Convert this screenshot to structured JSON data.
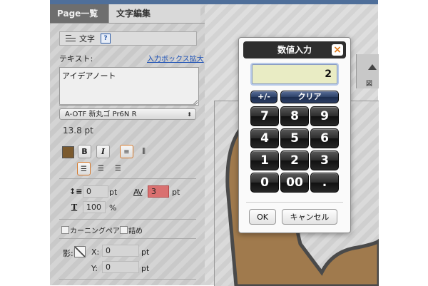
{
  "tabs": {
    "page_list": "Page一覧",
    "text_edit": "文字編集"
  },
  "section": {
    "title": "文字",
    "help": "?"
  },
  "text_field": {
    "label": "テキスト:",
    "expand_link": "入力ボックス拡大",
    "value": "アイデアノート"
  },
  "font": {
    "selected": "A-OTF 新丸ゴ Pr6N R",
    "size": "13.8",
    "size_unit": "pt"
  },
  "style_buttons": {
    "bold": "B",
    "italic": "I"
  },
  "spacing": {
    "line_value": "0",
    "line_unit": "pt",
    "av_label": "AV",
    "tracking_value": "3",
    "tracking_unit": "pt",
    "scale_value": "100",
    "scale_unit": "%"
  },
  "checkboxes": {
    "kerning": "カーニングペア",
    "tsume": "詰め"
  },
  "shadow": {
    "label": "影:",
    "x_label": "X:",
    "x_value": "0",
    "y_label": "Y:",
    "y_value": "0",
    "unit": "pt"
  },
  "dialog": {
    "title": "数値入力",
    "close": "×",
    "display_value": "2",
    "plus_minus": "+/-",
    "clear": "クリア",
    "keys": [
      "7",
      "8",
      "9",
      "4",
      "5",
      "6",
      "1",
      "2",
      "3",
      "0",
      "00",
      "."
    ],
    "ok": "OK",
    "cancel": "キャンセル"
  },
  "ruler_label": "図",
  "colors": {
    "accent": "#d5782a",
    "swatch": "#7b5a2e",
    "display_bg": "#e9ecc4",
    "tracking_bg": "#d97070",
    "title_bar": "#2e2e2e"
  }
}
